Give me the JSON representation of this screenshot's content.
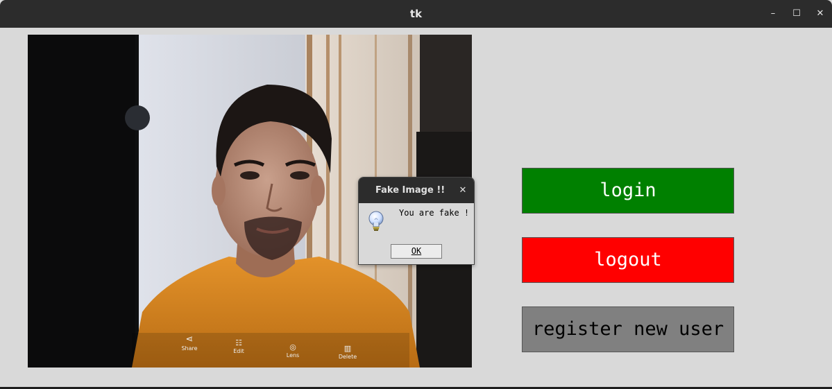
{
  "window": {
    "title": "tk",
    "controls": {
      "minimize": "–",
      "maximize": "☐",
      "close": "✕"
    }
  },
  "camera": {
    "overlay_items": [
      {
        "label": "Share",
        "icon": "share-icon"
      },
      {
        "label": "Edit",
        "icon": "edit-icon"
      },
      {
        "label": "Lens",
        "icon": "lens-icon"
      },
      {
        "label": "Delete",
        "icon": "trash-icon"
      }
    ]
  },
  "buttons": {
    "login": {
      "label": "login",
      "color": "#008000"
    },
    "logout": {
      "label": "logout",
      "color": "#ff0000"
    },
    "register": {
      "label": "register new user",
      "color": "#808080"
    }
  },
  "dialog": {
    "title": "Fake Image !!",
    "close": "✕",
    "message": "You are fake !",
    "ok_label": "OK",
    "icon": "lightbulb-icon"
  },
  "colors": {
    "titlebar": "#2c2c2c",
    "background": "#d9d9d9",
    "shirt": "#e08a1e"
  }
}
